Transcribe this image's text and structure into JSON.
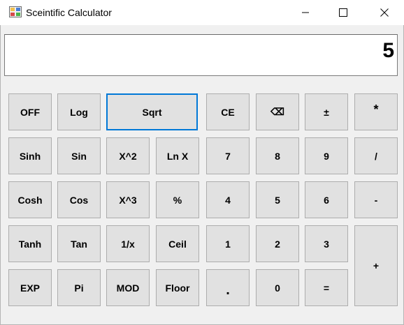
{
  "window": {
    "title": "Sceintific Calculator"
  },
  "display": {
    "value": "5"
  },
  "buttons": {
    "off": "OFF",
    "log": "Log",
    "sqrt": "Sqrt",
    "ce": "CE",
    "backspace": "⌫",
    "plus_minus": "±",
    "multiply": "*",
    "sinh": "Sinh",
    "sin": "Sin",
    "x_squared": "X^2",
    "ln_x": "Ln X",
    "seven": "7",
    "eight": "8",
    "nine": "9",
    "divide": "/",
    "cosh": "Cosh",
    "cos": "Cos",
    "x_cubed": "X^3",
    "percent": "%",
    "four": "4",
    "five": "5",
    "six": "6",
    "minus": "-",
    "tanh": "Tanh",
    "tan": "Tan",
    "reciprocal": "1/x",
    "ceil": "Ceil",
    "one": "1",
    "two": "2",
    "three": "3",
    "plus": "+",
    "exp": "EXP",
    "pi": "Pi",
    "mod": "MOD",
    "floor": "Floor",
    "decimal": ".",
    "zero": "0",
    "equals": "="
  },
  "colors": {
    "focus_border": "#0078d7",
    "button_face": "#e1e1e1",
    "client_bg": "#f0f0f0"
  }
}
